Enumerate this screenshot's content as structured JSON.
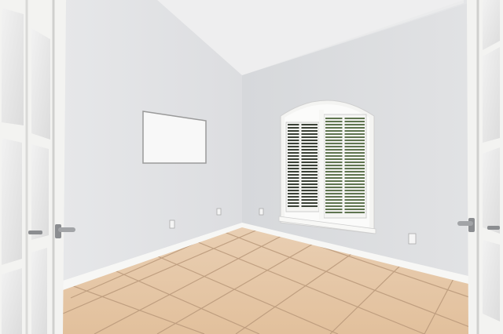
{
  "scene": {
    "kind": "empty room photograph",
    "objects": [
      "french-door-left",
      "french-door-right",
      "whiteboard",
      "arched-window-with-shutters",
      "tile-floor",
      "baseboards",
      "wall-outlets",
      "door-handles"
    ]
  },
  "colors": {
    "ceiling": "#eceded",
    "wall_left": "#e3e4e6",
    "wall_back": "#dcdee0",
    "floor_tile": "#e6c9a8",
    "grout": "#b9987a",
    "trim": "#f7f7f5",
    "whiteboard": "#f8f8f8",
    "shutter_dark": "#2a2f2a",
    "foliage": "#5f7550"
  }
}
